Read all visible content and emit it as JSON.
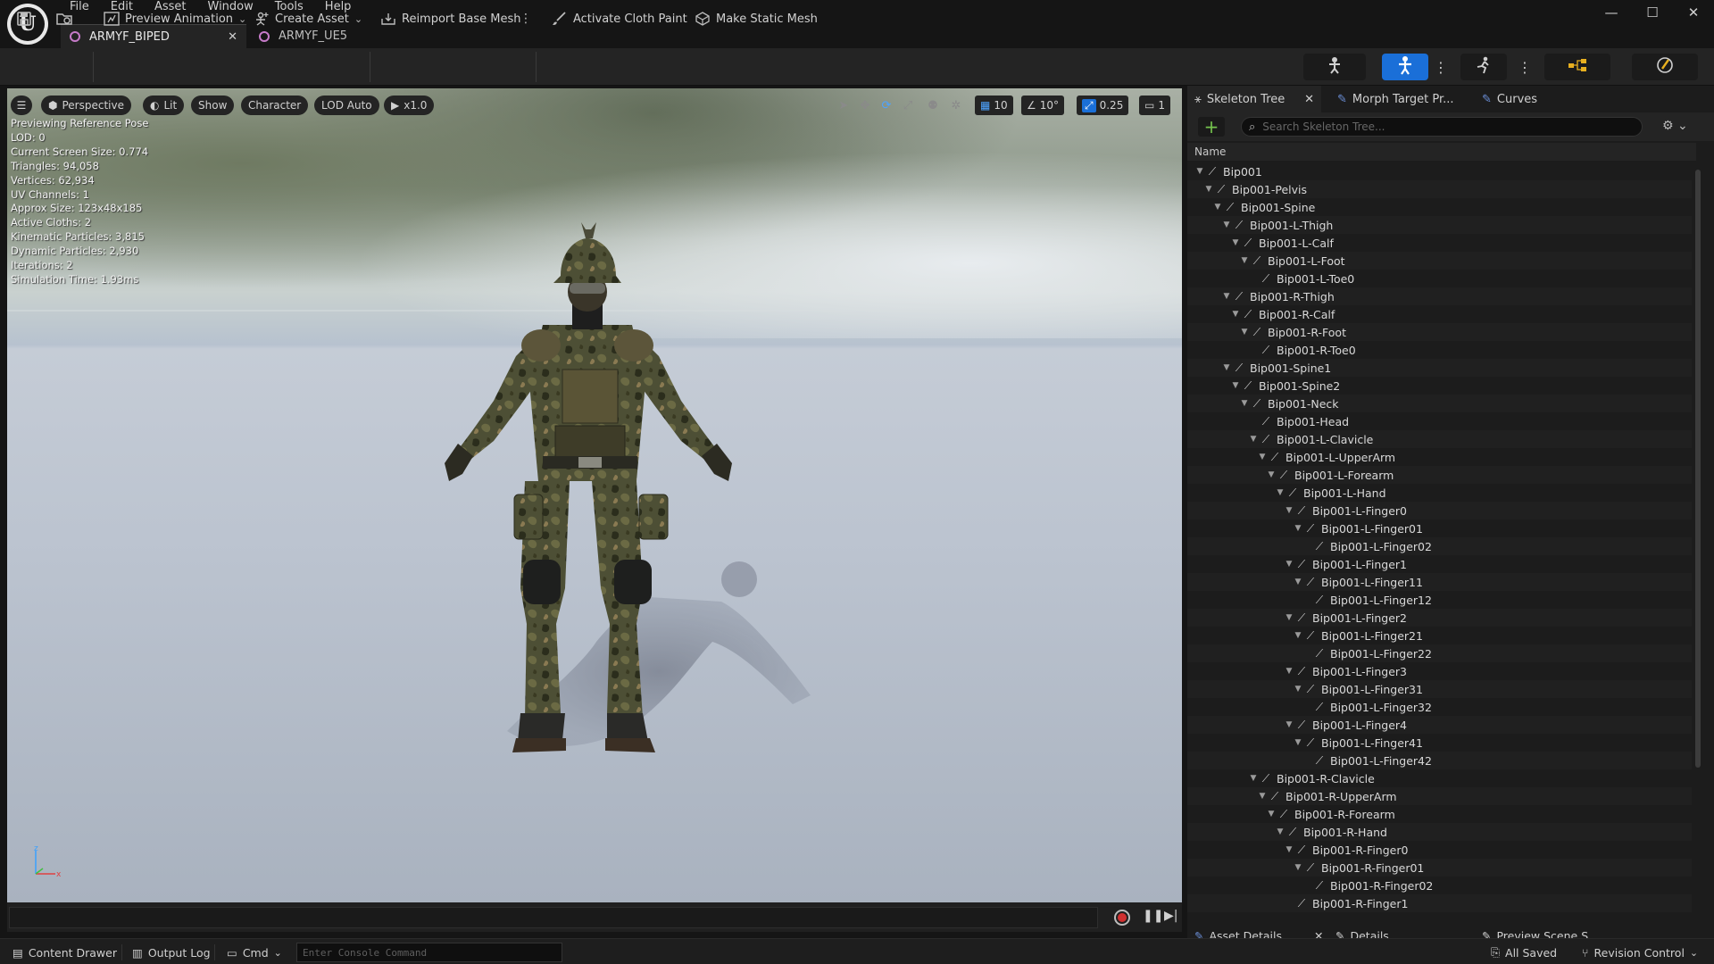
{
  "menu": [
    "File",
    "Edit",
    "Asset",
    "Window",
    "Tools",
    "Help"
  ],
  "tabs": [
    {
      "label": "ARMYF_BIPED",
      "active": true
    },
    {
      "label": "ARMYF_UE5",
      "active": false
    }
  ],
  "toolbar": {
    "preview_animation": "Preview Animation",
    "create_asset": "Create Asset",
    "reimport": "Reimport Base Mesh",
    "cloth_paint": "Activate Cloth Paint",
    "static_mesh": "Make Static Mesh"
  },
  "viewport": {
    "perspective": "Perspective",
    "lit": "Lit",
    "show": "Show",
    "character": "Character",
    "lod": "LOD Auto",
    "speed": "x1.0",
    "grid_size": "10",
    "rotation_snap": "10°",
    "scale_snap": "0.25",
    "camera_speed": "1",
    "stats": [
      "Previewing Reference Pose",
      "LOD: 0",
      "Current Screen Size: 0.774",
      "Triangles: 94,058",
      "Vertices: 62,934",
      "UV Channels: 1",
      "Approx Size: 123x48x185",
      "Active Cloths: 2",
      "Kinematic Particles: 3,815",
      "Dynamic Particles: 2,930",
      "Iterations: 2",
      "Simulation Time: 1.93ms"
    ]
  },
  "panel": {
    "tabs": [
      "Skeleton Tree",
      "Morph Target Pr...",
      "Curves"
    ],
    "search_placeholder": "Search Skeleton Tree...",
    "column_name": "Name",
    "bones": [
      {
        "name": "Bip001",
        "depth": 0
      },
      {
        "name": "Bip001-Pelvis",
        "depth": 1
      },
      {
        "name": "Bip001-Spine",
        "depth": 2
      },
      {
        "name": "Bip001-L-Thigh",
        "depth": 3
      },
      {
        "name": "Bip001-L-Calf",
        "depth": 4
      },
      {
        "name": "Bip001-L-Foot",
        "depth": 5
      },
      {
        "name": "Bip001-L-Toe0",
        "depth": 6
      },
      {
        "name": "Bip001-R-Thigh",
        "depth": 3
      },
      {
        "name": "Bip001-R-Calf",
        "depth": 4
      },
      {
        "name": "Bip001-R-Foot",
        "depth": 5
      },
      {
        "name": "Bip001-R-Toe0",
        "depth": 6
      },
      {
        "name": "Bip001-Spine1",
        "depth": 3
      },
      {
        "name": "Bip001-Spine2",
        "depth": 4
      },
      {
        "name": "Bip001-Neck",
        "depth": 5
      },
      {
        "name": "Bip001-Head",
        "depth": 6
      },
      {
        "name": "Bip001-L-Clavicle",
        "depth": 6
      },
      {
        "name": "Bip001-L-UpperArm",
        "depth": 7
      },
      {
        "name": "Bip001-L-Forearm",
        "depth": 8
      },
      {
        "name": "Bip001-L-Hand",
        "depth": 9
      },
      {
        "name": "Bip001-L-Finger0",
        "depth": 10
      },
      {
        "name": "Bip001-L-Finger01",
        "depth": 11
      },
      {
        "name": "Bip001-L-Finger02",
        "depth": 12
      },
      {
        "name": "Bip001-L-Finger1",
        "depth": 10
      },
      {
        "name": "Bip001-L-Finger11",
        "depth": 11
      },
      {
        "name": "Bip001-L-Finger12",
        "depth": 12
      },
      {
        "name": "Bip001-L-Finger2",
        "depth": 10
      },
      {
        "name": "Bip001-L-Finger21",
        "depth": 11
      },
      {
        "name": "Bip001-L-Finger22",
        "depth": 12
      },
      {
        "name": "Bip001-L-Finger3",
        "depth": 10
      },
      {
        "name": "Bip001-L-Finger31",
        "depth": 11
      },
      {
        "name": "Bip001-L-Finger32",
        "depth": 12
      },
      {
        "name": "Bip001-L-Finger4",
        "depth": 10
      },
      {
        "name": "Bip001-L-Finger41",
        "depth": 11
      },
      {
        "name": "Bip001-L-Finger42",
        "depth": 12
      },
      {
        "name": "Bip001-R-Clavicle",
        "depth": 6
      },
      {
        "name": "Bip001-R-UpperArm",
        "depth": 7
      },
      {
        "name": "Bip001-R-Forearm",
        "depth": 8
      },
      {
        "name": "Bip001-R-Hand",
        "depth": 9
      },
      {
        "name": "Bip001-R-Finger0",
        "depth": 10
      },
      {
        "name": "Bip001-R-Finger01",
        "depth": 11
      },
      {
        "name": "Bip001-R-Finger02",
        "depth": 12
      },
      {
        "name": "Bip001-R-Finger1",
        "depth": 10
      }
    ]
  },
  "bottom_tabs": [
    "Asset Details",
    "Details",
    "Preview Scene S..."
  ],
  "status": {
    "content_drawer": "Content Drawer",
    "output_log": "Output Log",
    "cmd": "Cmd",
    "console_placeholder": "Enter Console Command",
    "all_saved": "All Saved",
    "revision_control": "Revision Control"
  },
  "colors": {
    "accent_blue": "#1a6fd8",
    "add_green": "#74c24d",
    "record_red": "#d03030",
    "tab_icon_pink": "#c67bc9"
  }
}
